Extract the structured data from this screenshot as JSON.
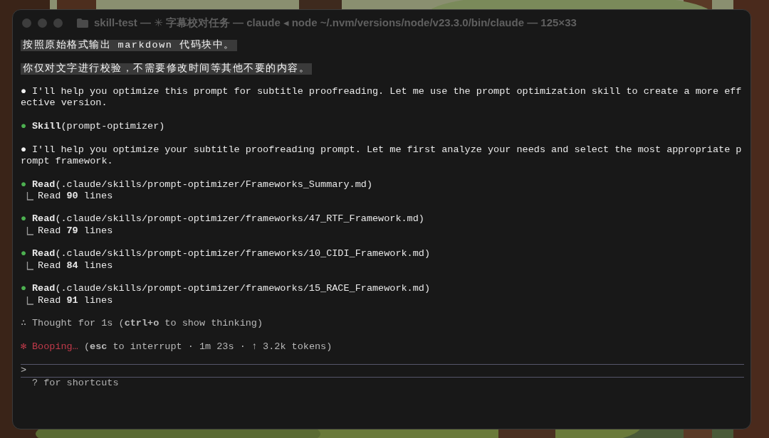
{
  "window": {
    "title": "skill-test — ✳ 字幕校对任务 — claude ◂ node ~/.nvm/versions/node/v23.3.0/bin/claude — 125×33"
  },
  "messages": [
    {
      "kind": "user",
      "text": "按照原始格式输出 markdown 代码块中。"
    },
    {
      "kind": "user",
      "text": "你仅对文字进行校验，不需要修改时间等其他不要的内容。"
    },
    {
      "kind": "assistant",
      "symbol": "●",
      "lines": [
        "I'll help you optimize this prompt for subtitle proofreading. Let me use the prompt optimization skill to create a more eff",
        "ective version."
      ]
    },
    {
      "kind": "tool",
      "symbol": "●",
      "tool": "Skill",
      "args": "(prompt-optimizer)"
    },
    {
      "kind": "assistant",
      "symbol": "●",
      "lines": [
        "I'll help you optimize your subtitle proofreading prompt. Let me first analyze your needs and select the most appropriate p",
        "rompt framework."
      ]
    },
    {
      "kind": "tool",
      "symbol": "●",
      "tool": "Read",
      "args": "(.claude/skills/prompt-optimizer/Frameworks_Summary.md)",
      "result": "Read **90** lines"
    },
    {
      "kind": "tool",
      "symbol": "●",
      "tool": "Read",
      "args": "(.claude/skills/prompt-optimizer/frameworks/47_RTF_Framework.md)",
      "result": "Read **79** lines"
    },
    {
      "kind": "tool",
      "symbol": "●",
      "tool": "Read",
      "args": "(.claude/skills/prompt-optimizer/frameworks/10_CIDI_Framework.md)",
      "result": "Read **84** lines"
    },
    {
      "kind": "tool",
      "symbol": "●",
      "tool": "Read",
      "args": "(.claude/skills/prompt-optimizer/frameworks/15_RACE_Framework.md)",
      "result": "Read **91** lines"
    },
    {
      "kind": "thinking",
      "symbol": "∴",
      "text": "Thought for 1s (**ctrl+o** to show thinking)"
    },
    {
      "kind": "status",
      "symbol": "✻",
      "verb": "Booping…",
      "text": "(**esc** to interrupt · 1m 23s · ↑ 3.2k tokens)"
    }
  ],
  "input": {
    "prompt": ">"
  },
  "footer": {
    "hint": "? for shortcuts"
  }
}
